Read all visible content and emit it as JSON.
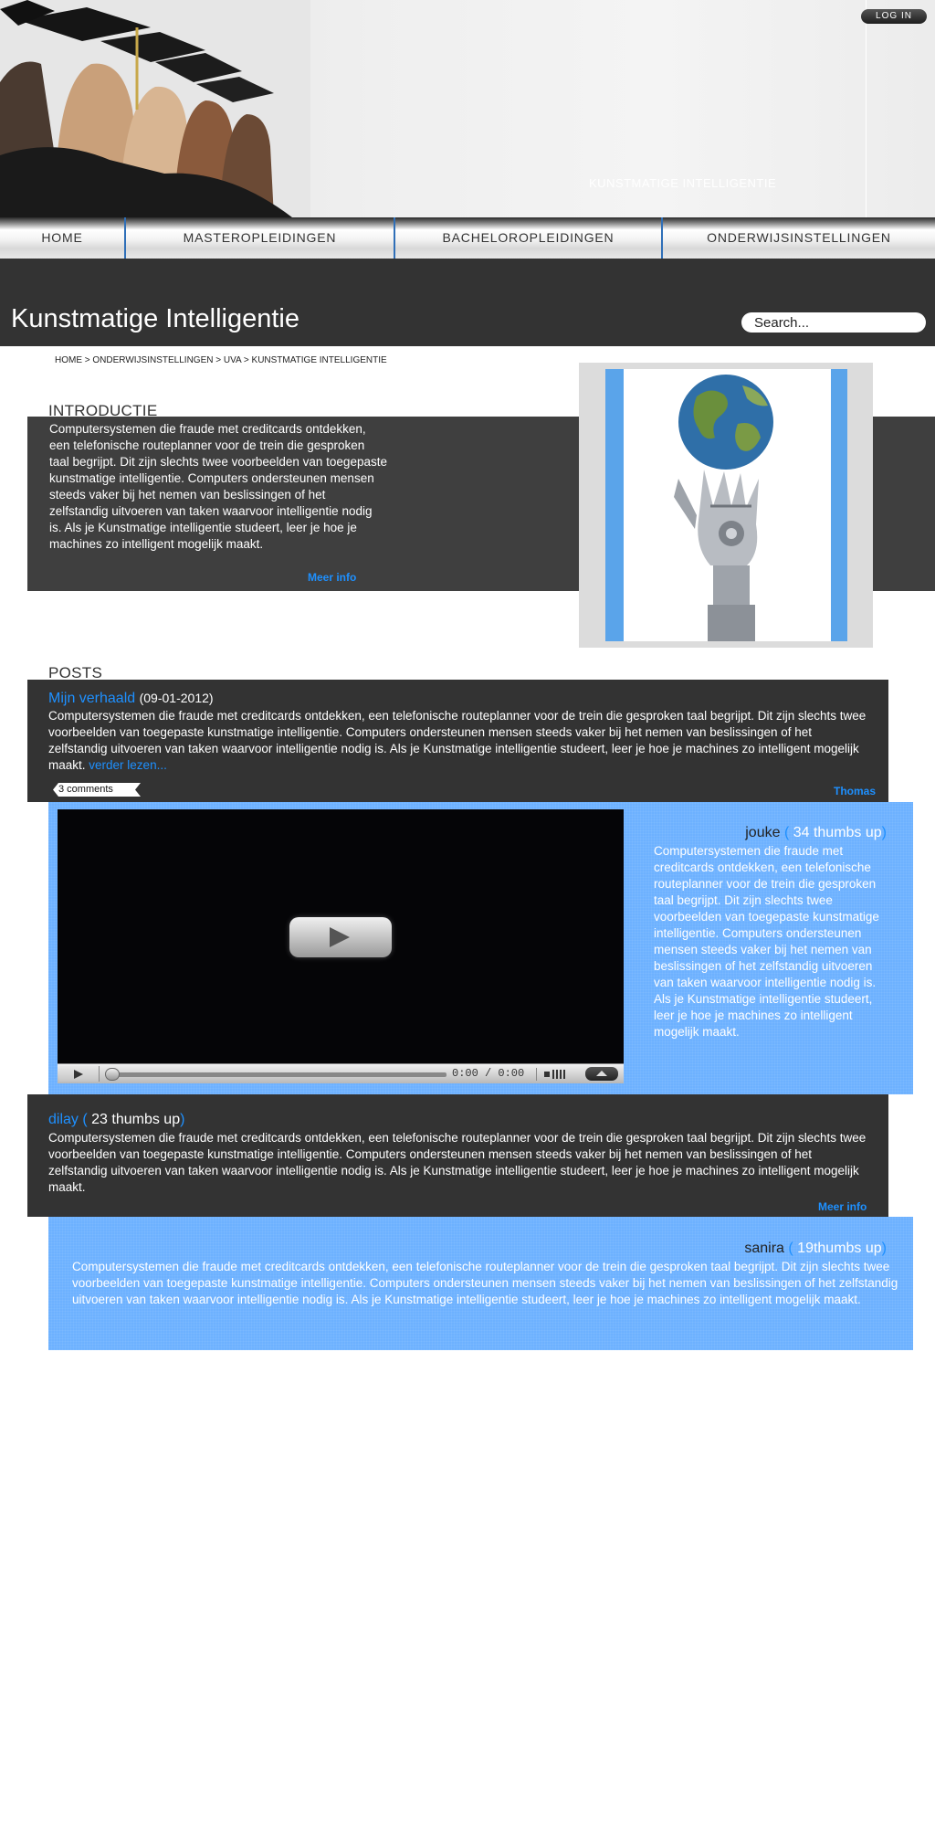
{
  "header": {
    "login": "LOG IN",
    "caption": "KUNSTMATIGE INTELLIGENTIE"
  },
  "nav": {
    "items": [
      "HOME",
      "MASTEROPLEIDINGEN",
      "BACHELOROPLEIDINGEN",
      "ONDERWIJSINSTELLINGEN"
    ]
  },
  "title": "Kunstmatige Intelligentie",
  "search": {
    "placeholder": "Search..."
  },
  "breadcrumb": "HOME > ONDERWIJSINSTELLINGEN > UVA > KUNSTMATIGE INTELLIGENTIE",
  "intro": {
    "heading": "INTRODUCTIE",
    "text": "Computersystemen die fraude met creditcards ontdekken, een telefonische routeplanner voor de trein die gesproken taal begrijpt. Dit zijn slechts twee voorbeelden van toegepaste kunstmatige intelligentie. Computers ondersteunen mensen steeds vaker bij het nemen van beslissingen of het zelfstandig uitvoeren van taken waarvoor intelligentie nodig is. Als je Kunstmatige intelligentie studeert, leer je hoe je machines zo intelligent mogelijk maakt.",
    "more": "Meer info"
  },
  "posts": {
    "heading": "POSTS",
    "main": {
      "title": "Mijn verhaald",
      "date": "(09-01-2012)",
      "text": "Computersystemen die fraude met creditcards ontdekken, een telefonische routeplanner voor de trein die gesproken taal begrijpt. Dit zijn slechts twee voorbeelden van toegepaste kunstmatige intelligentie. Computers ondersteunen mensen steeds vaker bij het nemen van beslissingen of het zelfstandig uitvoeren van taken waarvoor intelligentie nodig is. Als je Kunstmatige intelligentie studeert, leer je hoe je machines zo intelligent mogelijk maakt.",
      "read_more": "verder lezen...",
      "comments": "3 comments",
      "author": "Thomas"
    },
    "comments": [
      {
        "name": "jouke",
        "open": "(",
        "thumbs": " 34 thumbs up",
        "close": ")",
        "text": "Computersystemen die fraude met creditcards ontdekken, een telefonische routeplanner voor de trein die gesproken taal begrijpt. Dit zijn slechts twee voorbeelden van toegepaste kunstmatige intelligentie. Computers ondersteunen mensen steeds vaker bij het nemen van beslissingen of het zelfstandig uitvoeren van taken waarvoor intelligentie nodig is. Als je Kunstmatige intelligentie studeert, leer je hoe je machines zo intelligent mogelijk maakt."
      },
      {
        "name": "dilay",
        "open": "(",
        "thumbs": " 23 thumbs up",
        "close": ")",
        "text": "Computersystemen die fraude met creditcards ontdekken, een telefonische routeplanner voor de trein die gesproken taal begrijpt. Dit zijn slechts twee voorbeelden van toegepaste kunstmatige intelligentie. Computers ondersteunen mensen steeds vaker bij het nemen van beslissingen of het zelfstandig uitvoeren van taken waarvoor intelligentie nodig is. Als je Kunstmatige intelligentie studeert, leer je hoe je machines zo intelligent mogelijk maakt.",
        "more": "Meer info"
      },
      {
        "name": "sanira",
        "open": "(",
        "thumbs": " 19thumbs up",
        "close": ")",
        "text": "Computersystemen die fraude met creditcards ontdekken, een telefonische routeplanner voor de trein die gesproken taal begrijpt. Dit zijn slechts twee voorbeelden van toegepaste kunstmatige intelligentie. Computers ondersteunen mensen steeds vaker bij het nemen van beslissingen of het zelfstandig uitvoeren van taken waarvoor intelligentie nodig is. Als je Kunstmatige intelligentie studeert, leer je hoe je machines zo intelligent mogelijk maakt."
      }
    ]
  },
  "video": {
    "timecode": "0:00 / 0:00",
    "icons": [
      "play-icon",
      "volume-icon",
      "fullscreen-icon"
    ]
  },
  "colors": {
    "dark_band": "#333333",
    "accent_blue": "#1e90ff",
    "comment_blue": "#6db1ff"
  }
}
